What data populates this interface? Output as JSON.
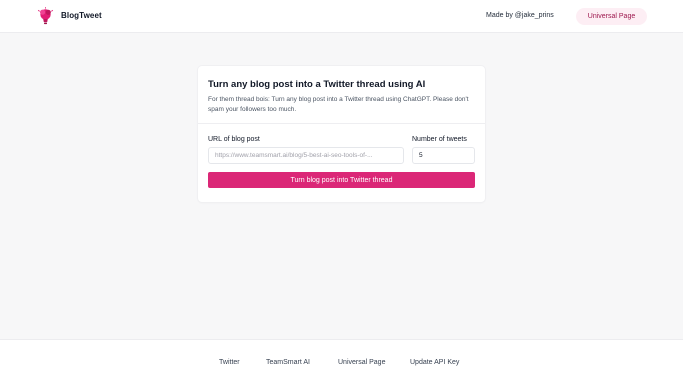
{
  "header": {
    "brand": "BlogTweet",
    "made_by": "Made by @jake_prins",
    "universal_page_label": "Universal Page"
  },
  "form": {
    "title": "Turn any blog post into a Twitter thread using AI",
    "description": "For them thread bois: Turn any blog post into a Twitter thread using ChatGPT. Please don't spam your followers too much.",
    "url_label": "URL of blog post",
    "url_placeholder": "https://www.teamsmart.ai/blog/5-best-ai-seo-tools-of-...",
    "tweets_label": "Number of tweets",
    "tweets_value": "5",
    "submit_label": "Turn blog post into Twitter thread"
  },
  "footer": {
    "links": [
      "Twitter",
      "TeamSmart AI",
      "Universal Page",
      "Update API Key"
    ]
  },
  "colors": {
    "accent": "#db2777",
    "pill_bg": "#fdeef4",
    "pill_text": "#9d174d",
    "page_bg": "#f7f7f8"
  },
  "icons": {
    "logo": "brain-lightbulb-icon"
  }
}
